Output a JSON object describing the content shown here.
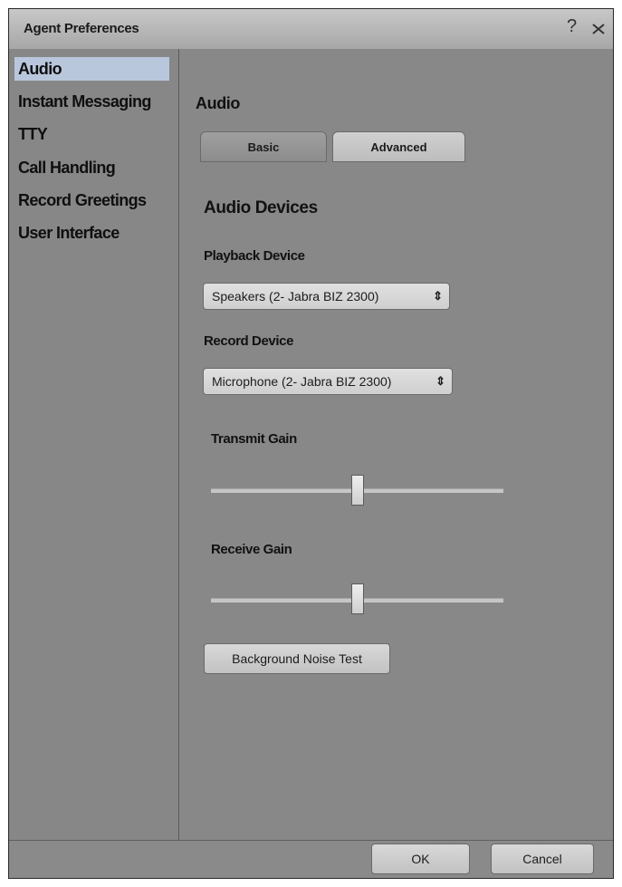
{
  "window": {
    "title": "Agent Preferences"
  },
  "sidebar": {
    "items": [
      {
        "label": "Audio",
        "active": true
      },
      {
        "label": "Instant Messaging"
      },
      {
        "label": "TTY"
      },
      {
        "label": "Call Handling"
      },
      {
        "label": "Record Greetings"
      },
      {
        "label": "User Interface"
      }
    ]
  },
  "main": {
    "section_title": "Audio",
    "tabs": [
      {
        "label": "Basic"
      },
      {
        "label": "Advanced",
        "active": true
      }
    ],
    "audio_devices_title": "Audio Devices",
    "playback": {
      "label": "Playback Device",
      "value": "Speakers (2- Jabra BIZ 2300)"
    },
    "record": {
      "label": "Record Device",
      "value": "Microphone (2- Jabra BIZ 2300)"
    },
    "transmit_gain": {
      "label": "Transmit Gain",
      "level": 0.5
    },
    "receive_gain": {
      "label": "Receive Gain",
      "level": 0.5
    },
    "noise_test_label": "Background Noise Test"
  },
  "footer": {
    "ok_label": "OK",
    "cancel_label": "Cancel"
  },
  "icons": {
    "help": "help-icon",
    "close": "close-icon",
    "dropdown": "updown-arrow-icon"
  }
}
